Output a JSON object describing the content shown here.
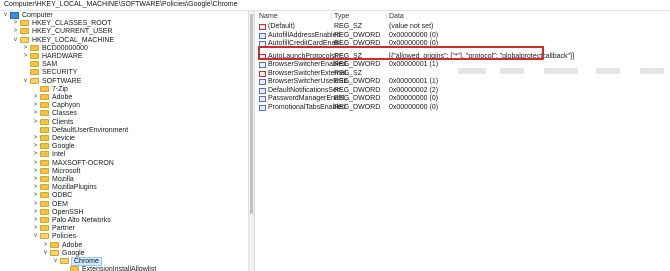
{
  "address_bar": {
    "path": "Computer\\HKEY_LOCAL_MACHINE\\SOFTWARE\\Policies\\Google\\Chrome"
  },
  "tree": {
    "items": [
      {
        "label": "Computer",
        "chevron": "v",
        "icon": "computer-icon"
      },
      {
        "label": "HKEY_CLASSES_ROOT",
        "chevron": ">",
        "icon": "folder-icon"
      },
      {
        "label": "HKEY_CURRENT_USER",
        "chevron": ">",
        "icon": "folder-icon"
      },
      {
        "label": "HKEY_LOCAL_MACHINE",
        "chevron": "v",
        "icon": "folder-open-icon"
      },
      {
        "label": "BCD00000000",
        "chevron": ">",
        "icon": "folder-icon"
      },
      {
        "label": "HARDWARE",
        "chevron": ">",
        "icon": "folder-icon"
      },
      {
        "label": "SAM",
        "chevron": "",
        "icon": "folder-icon"
      },
      {
        "label": "SECURITY",
        "chevron": "",
        "icon": "folder-icon"
      },
      {
        "label": "SOFTWARE",
        "chevron": "v",
        "icon": "folder-open-icon"
      },
      {
        "label": "7-Zip",
        "chevron": "",
        "icon": "folder-icon"
      },
      {
        "label": "Adobe",
        "chevron": ">",
        "icon": "folder-icon"
      },
      {
        "label": "Caphyon",
        "chevron": ">",
        "icon": "folder-icon"
      },
      {
        "label": "Classes",
        "chevron": ">",
        "icon": "folder-icon"
      },
      {
        "label": "Clients",
        "chevron": ">",
        "icon": "folder-icon"
      },
      {
        "label": "DefaultUserEnvironment",
        "chevron": "",
        "icon": "folder-icon"
      },
      {
        "label": "Devicie",
        "chevron": ">",
        "icon": "folder-icon"
      },
      {
        "label": "Google",
        "chevron": ">",
        "icon": "folder-icon"
      },
      {
        "label": "Intel",
        "chevron": ">",
        "icon": "folder-icon"
      },
      {
        "label": "MAXSOFT-OCRON",
        "chevron": ">",
        "icon": "folder-icon"
      },
      {
        "label": "Microsoft",
        "chevron": ">",
        "icon": "folder-icon"
      },
      {
        "label": "Mozilla",
        "chevron": ">",
        "icon": "folder-icon"
      },
      {
        "label": "MozillaPlugins",
        "chevron": ">",
        "icon": "folder-icon"
      },
      {
        "label": "ODBC",
        "chevron": ">",
        "icon": "folder-icon"
      },
      {
        "label": "OEM",
        "chevron": ">",
        "icon": "folder-icon"
      },
      {
        "label": "OpenSSH",
        "chevron": ">",
        "icon": "folder-icon"
      },
      {
        "label": "Palo Alto Networks",
        "chevron": ">",
        "icon": "folder-icon"
      },
      {
        "label": "Partner",
        "chevron": ">",
        "icon": "folder-icon"
      },
      {
        "label": "Policies",
        "chevron": "v",
        "icon": "folder-open-icon"
      },
      {
        "label": "Adobe",
        "chevron": ">",
        "icon": "folder-icon"
      },
      {
        "label": "Google",
        "chevron": "v",
        "icon": "folder-open-icon"
      },
      {
        "label": "Chrome",
        "chevron": "v",
        "icon": "folder-open-icon",
        "selected": true
      },
      {
        "label": "ExtensionInstallAllowlist",
        "chevron": "",
        "icon": "folder-icon"
      }
    ]
  },
  "list": {
    "headers": {
      "name": "Name",
      "type": "Type",
      "data": "Data"
    },
    "rows": [
      {
        "name": "(Default)",
        "type": "REG_SZ",
        "data": "(value not set)",
        "kind": "sz"
      },
      {
        "name": "AutofillAddressEnabled",
        "type": "REG_DWORD",
        "data": "0x00000000 (0)",
        "kind": "dword"
      },
      {
        "name": "AutofillCreditCardEnabl...",
        "type": "REG_DWORD",
        "data": "0x00000000 (0)",
        "kind": "dword"
      },
      {
        "name": "AutoLaunchProtocolsFr...",
        "type": "REG_SZ",
        "data": "[{\"allowed_origins\": [\"*\"], \"protocol\": \"globalprotectcallback\"}]",
        "kind": "sz"
      },
      {
        "name": "BrowserSwitcherEnabled",
        "type": "REG_DWORD",
        "data": "0x00000001 (1)",
        "kind": "dword"
      },
      {
        "name": "BrowserSwitcherExternal...",
        "type": "REG_SZ",
        "data": "",
        "kind": "sz"
      },
      {
        "name": "BrowserSwitcherUseIeSit...",
        "type": "REG_DWORD",
        "data": "0x00000001 (1)",
        "kind": "dword"
      },
      {
        "name": "DefaultNotificationsSett...",
        "type": "REG_DWORD",
        "data": "0x00000002 (2)",
        "kind": "dword"
      },
      {
        "name": "PasswordManagerEnabl...",
        "type": "REG_DWORD",
        "data": "0x00000000 (0)",
        "kind": "dword"
      },
      {
        "name": "PromotionalTabsEnabled",
        "type": "REG_DWORD",
        "data": "0x00000000 (0)",
        "kind": "dword"
      }
    ]
  },
  "colors": {
    "highlight_border": "#d12b2b",
    "folder": "#f2c541",
    "selection": "#cfe8fc"
  }
}
